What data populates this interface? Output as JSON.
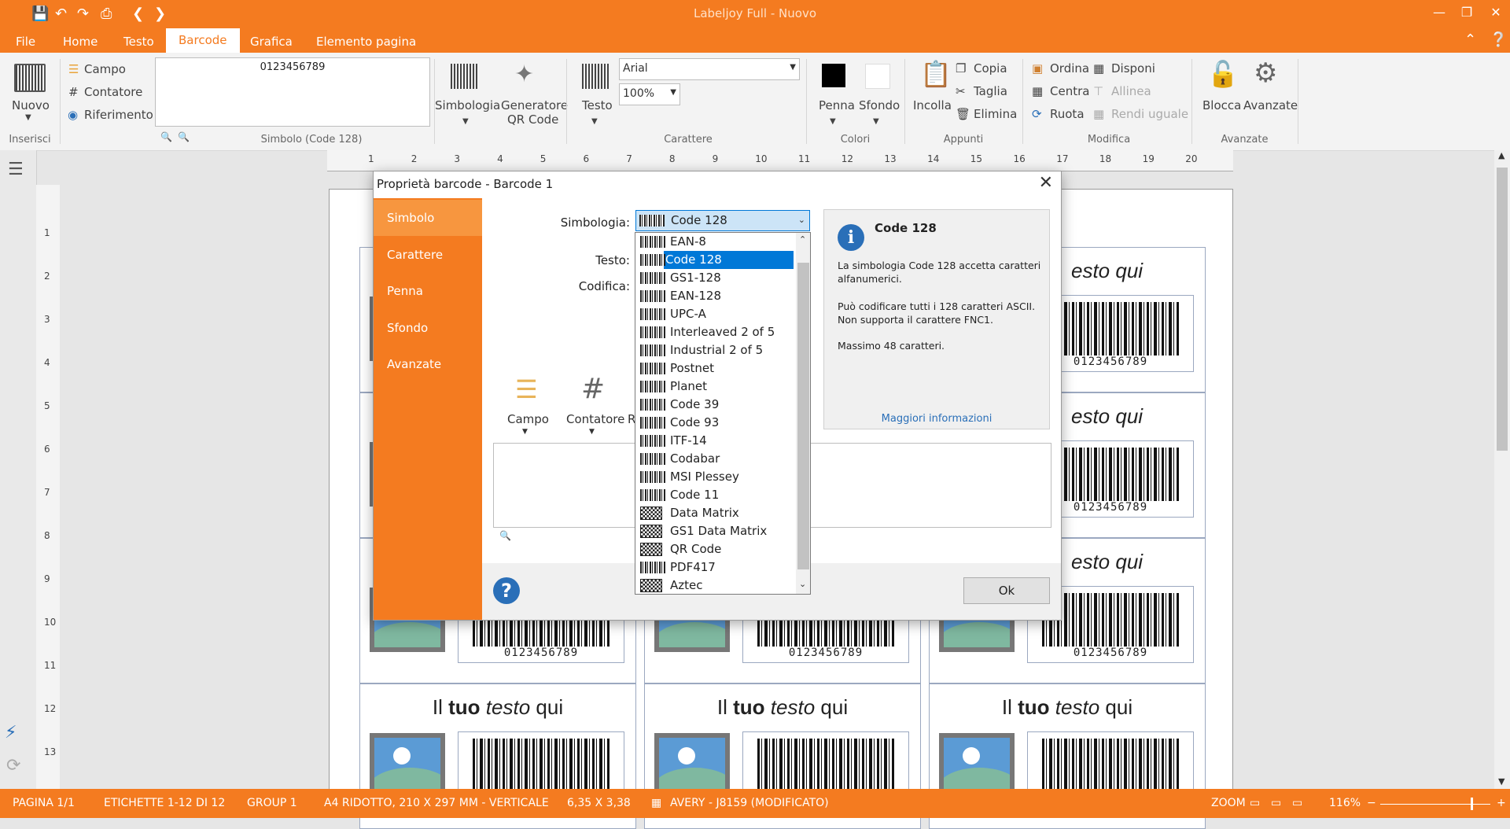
{
  "titlebar": {
    "title": "Labeljoy Full - Nuovo"
  },
  "menu": {
    "file": "File",
    "home": "Home",
    "testo": "Testo",
    "barcode": "Barcode",
    "grafica": "Grafica",
    "elemento": "Elemento pagina"
  },
  "ribbon": {
    "nuovo": "Nuovo",
    "inserisci": "Inserisci",
    "campo": "Campo",
    "contatore": "Contatore",
    "riferimento": "Riferimento",
    "barcode_value": "0123456789",
    "simbolo_group": "Simbolo (Code 128)",
    "simbologia": "Simbologia",
    "generatore_1": "Generatore",
    "generatore_2": "QR Code",
    "testo": "Testo",
    "font": "Arial",
    "size": "100%",
    "carattere_group": "Carattere",
    "penna": "Penna",
    "sfondo": "Sfondo",
    "colori_group": "Colori",
    "incolla": "Incolla",
    "copia": "Copia",
    "taglia": "Taglia",
    "elimina": "Elimina",
    "appunti_group": "Appunti",
    "ordina": "Ordina",
    "centra": "Centra",
    "ruota": "Ruota",
    "disponi": "Disponi",
    "allinea": "Allinea",
    "rendi_uguale": "Rendi uguale",
    "modifica_group": "Modifica",
    "blocca": "Blocca",
    "avanzate": "Avanzate",
    "avanzate_group": "Avanzate"
  },
  "ruler": {
    "h": [
      "1",
      "2",
      "3",
      "4",
      "5",
      "6",
      "7",
      "8",
      "9",
      "10",
      "11",
      "12",
      "13",
      "14",
      "15",
      "16",
      "17",
      "18",
      "19",
      "20"
    ],
    "v": [
      "1",
      "2",
      "3",
      "4",
      "5",
      "6",
      "7",
      "8",
      "9",
      "10",
      "11",
      "12",
      "13"
    ]
  },
  "labels": {
    "text_pre": "Il ",
    "text_bold": "tuo",
    "text_mid": " ",
    "text_italic": "testo",
    "text_post": " qui",
    "partial_text": "esto qui",
    "barcode_number": "0123456789"
  },
  "dialog": {
    "title": "Proprietà barcode - Barcode 1",
    "nav": [
      "Simbolo",
      "Carattere",
      "Penna",
      "Sfondo",
      "Avanzate"
    ],
    "simbologia_label": "Simbologia:",
    "testo_label": "Testo:",
    "codifica_label": "Codifica:",
    "selected": "Code 128",
    "options": [
      "EAN-8",
      "Code 128",
      "GS1-128",
      "EAN-128",
      "UPC-A",
      "Interleaved 2 of 5",
      "Industrial 2 of 5",
      "Postnet",
      "Planet",
      "Code 39",
      "Code 93",
      "ITF-14",
      "Codabar",
      "MSI Plessey",
      "Code 11",
      "Data Matrix",
      "GS1 Data Matrix",
      "QR Code",
      "PDF417",
      "Aztec"
    ],
    "campo": "Campo",
    "contatore": "Contatore",
    "r_partial": "R",
    "info_title": "Code 128",
    "info_p1": "La simbologia Code 128 accetta caratteri alfanumerici.",
    "info_p2": "Può codificare tutti i 128 caratteri ASCII. Non supporta il carattere FNC1.",
    "info_p3": "Massimo 48 caratteri.",
    "info_link": "Maggiori informazioni",
    "ok": "Ok"
  },
  "status": {
    "pagina": "PAGINA 1/1",
    "etichette": "ETICHETTE 1-12 DI 12",
    "group": "GROUP 1",
    "formato": "A4 RIDOTTO, 210 X 297 MM - VERTICALE",
    "dimensioni": "6,35 X 3,38",
    "avery": "AVERY - J8159 (MODIFICATO)",
    "zoom_label": "ZOOM",
    "zoom_value": "116%",
    "zoom_level": 0.82
  },
  "colors": {
    "accent": "#f47b20",
    "selection": "#0078d7"
  }
}
